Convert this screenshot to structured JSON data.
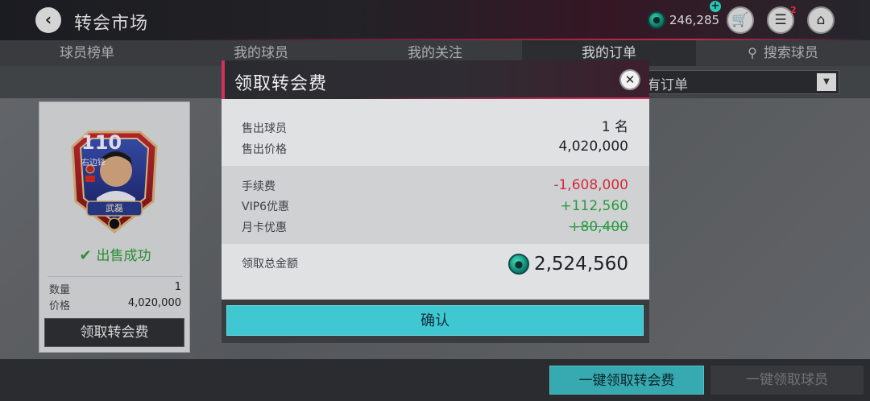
{
  "header": {
    "title": "转会市场",
    "coins": "246,285",
    "notifications": "2"
  },
  "tabs": [
    {
      "label": "球员榜单"
    },
    {
      "label": "我的球员"
    },
    {
      "label": "我的关注"
    },
    {
      "label": "我的订单"
    },
    {
      "label": "搜索球员"
    }
  ],
  "filter": {
    "selected": "有订单"
  },
  "card": {
    "rating": "110",
    "position": "右边锋",
    "player_name": "武磊",
    "status": "出售成功",
    "qty_label": "数量",
    "qty_value": "1",
    "price_label": "价格",
    "price_value": "4,020,000",
    "collect_label": "领取转会费"
  },
  "modal": {
    "title": "领取转会费",
    "sold_players_label": "售出球员",
    "sold_players_value": "1 名",
    "sold_price_label": "售出价格",
    "sold_price_value": "4,020,000",
    "fee_label": "手续费",
    "fee_value": "-1,608,000",
    "vip_label": "VIP6优惠",
    "vip_value": "+112,560",
    "monthly_label": "月卡优惠",
    "monthly_value": "+80,400",
    "total_label": "领取总金额",
    "total_value": "2,524,560",
    "confirm_label": "确认"
  },
  "bottom": {
    "collect_all_fees": "一键领取转会费",
    "collect_all_players": "一键领取球员"
  },
  "colors": {
    "accent_cyan": "#3fc8d2",
    "accent_red": "#d0305a",
    "negative": "#d42a3e",
    "positive": "#2a9a40"
  }
}
